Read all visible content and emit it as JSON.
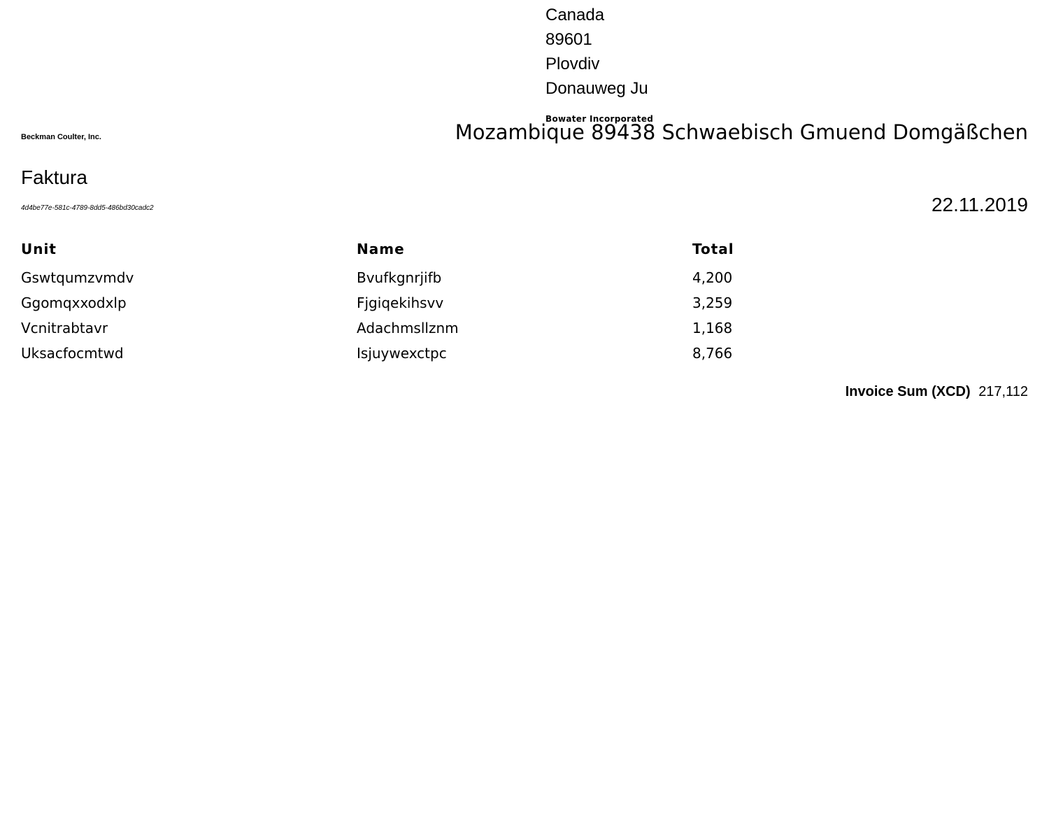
{
  "recipient": {
    "lines": [
      "Canada",
      "89601",
      "Plovdiv",
      "Donauweg Ju"
    ],
    "company": "Bowater Incorporated"
  },
  "sender": {
    "address": "Mozambique 89438 Schwaebisch Gmuend Domgäßchen",
    "company": "Beckman Coulter, Inc."
  },
  "document": {
    "title": "Faktura",
    "id": "4d4be77e-581c-4789-8dd5-486bd30cadc2",
    "date": "22.11.2019"
  },
  "table": {
    "headers": [
      "Unit",
      "Name",
      "Total"
    ],
    "rows": [
      [
        "Gswtqumzvmdv",
        "Bvufkgnrjifb",
        "4,200"
      ],
      [
        "Ggomqxxodxlp",
        "Fjgiqekihsvv",
        "3,259"
      ],
      [
        "Vcnitrabtavr",
        "Adachmsllznm",
        "1,168"
      ],
      [
        "Uksacfocmtwd",
        "Isjuywexctpc",
        "8,766"
      ]
    ]
  },
  "summary": {
    "label": "Invoice Sum (XCD)",
    "value": "217,112"
  }
}
